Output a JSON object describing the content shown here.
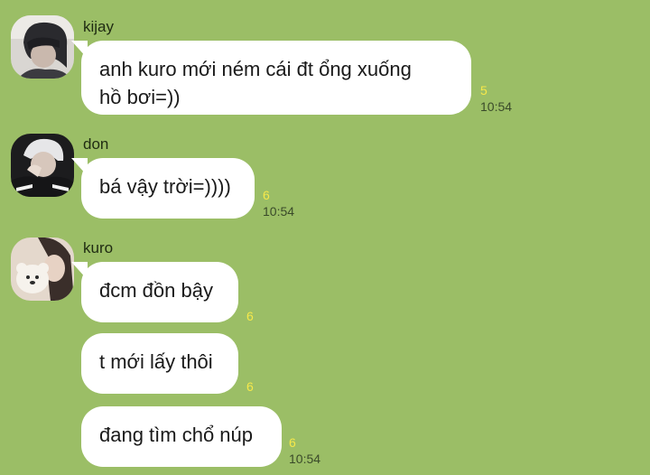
{
  "messages": [
    {
      "sender": "kijay",
      "avatar_icon": "profile-photo-icon",
      "bubbles": [
        {
          "lines": [
            "anh kuro mới ném cái đt ổng xuống",
            "hồ bơi=))"
          ],
          "count": "5",
          "time": "10:54"
        }
      ]
    },
    {
      "sender": "don",
      "avatar_icon": "profile-photo-icon",
      "bubbles": [
        {
          "lines": [
            "bá vậy trời=))))"
          ],
          "count": "6",
          "time": "10:54"
        }
      ]
    },
    {
      "sender": "kuro",
      "avatar_icon": "profile-photo-icon",
      "bubbles": [
        {
          "lines": [
            "đcm đồn bậy"
          ],
          "count": "6",
          "time": ""
        },
        {
          "lines": [
            "t mới lấy thôi"
          ],
          "count": "6",
          "time": ""
        },
        {
          "lines": [
            "đang tìm chổ núp"
          ],
          "count": "6",
          "time": "10:54"
        }
      ]
    }
  ],
  "colors": {
    "background": "#9bbe66",
    "bubble": "#ffffff",
    "read_count": "#f6e84a",
    "timestamp": "#3a4a2a"
  }
}
